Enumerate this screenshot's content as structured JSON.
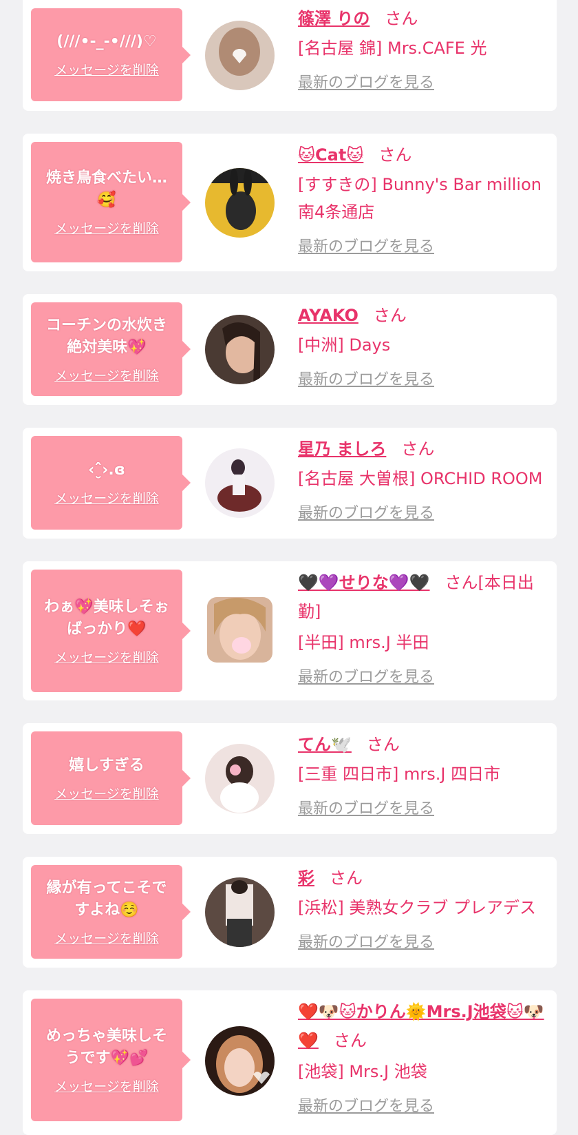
{
  "cards": [
    {
      "bubble_text": "(///•-_-•///)♡",
      "delete_label": "メッセージを削除",
      "name": "篠澤 りの",
      "honorific": "さん",
      "shop": "[名古屋 錦] Mrs.CAFE 光",
      "blog_label": "最新のブログを見る",
      "avatar_color": "#d9c7bb"
    },
    {
      "bubble_text": "焼き鳥食べたい… 🥰",
      "delete_label": "メッセージを削除",
      "name": "🐱Cat🐱",
      "honorific": "さん",
      "shop": "[すすきの] Bunny's Bar million 南4条通店",
      "blog_label": "最新のブログを見る",
      "avatar_color": "#e7b92f"
    },
    {
      "bubble_text": "コーチンの水炊き 絶対美味💖",
      "delete_label": "メッセージを削除",
      "name": "AYAKO",
      "honorific": "さん",
      "shop": "[中洲] Days",
      "blog_label": "最新のブログを見る",
      "avatar_color": "#4a3a33"
    },
    {
      "bubble_text": "‹ˆ̮›.ɞ",
      "delete_label": "メッセージを削除",
      "name": "星乃 ましろ",
      "honorific": "さん",
      "shop": "[名古屋 大曽根] ORCHID ROOM",
      "blog_label": "最新のブログを見る",
      "avatar_color": "#e9e4ec"
    },
    {
      "bubble_text": "わぁ💖美味しそぉ ばっかり❤️",
      "delete_label": "メッセージを削除",
      "name": "🖤💜せりな💜🖤",
      "honorific": "さん[本日出勤]",
      "shop": "[半田] mrs.J 半田",
      "blog_label": "最新のブログを見る",
      "avatar_color": "#d8b49b"
    },
    {
      "bubble_text": "嬉しすぎる",
      "delete_label": "メッセージを削除",
      "name": "てん🕊️",
      "honorific": "さん",
      "shop": "[三重 四日市] mrs.J 四日市",
      "blog_label": "最新のブログを見る",
      "avatar_color": "#e9d0cc"
    },
    {
      "bubble_text": "縁が有ってこそで すよね☺️",
      "delete_label": "メッセージを削除",
      "name": "彩",
      "honorific": "さん",
      "shop": "[浜松] 美熟女クラブ プレアデス",
      "blog_label": "最新のブログを見る",
      "avatar_color": "#5c4a42"
    },
    {
      "bubble_text": "めっちゃ美味しそ うです💖💕",
      "delete_label": "メッセージを削除",
      "name": "❤️🐶🐱かりん🌞Mrs.J池袋🐱🐶❤️",
      "honorific": "さん",
      "shop": "[池袋] Mrs.J 池袋",
      "blog_label": "最新のブログを見る",
      "avatar_color": "#c98a5f"
    }
  ]
}
